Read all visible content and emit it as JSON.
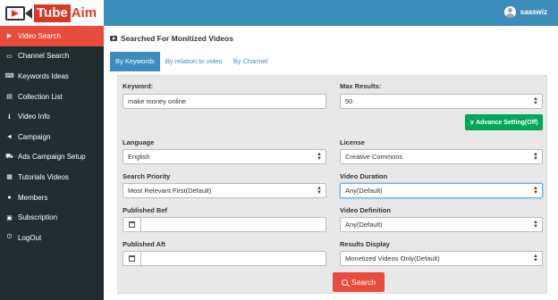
{
  "brand": {
    "tube": "Tube",
    "aim": "Aim"
  },
  "user": {
    "name": "saaswiz"
  },
  "sidebar": {
    "items": [
      {
        "label": "Video Search",
        "icon": "youtube-icon",
        "active": true
      },
      {
        "label": "Channel Search",
        "icon": "monitor-icon"
      },
      {
        "label": "Keywords Ideas",
        "icon": "keyboard-icon"
      },
      {
        "label": "Collection List",
        "icon": "list-icon"
      },
      {
        "label": "Video Info",
        "icon": "info-icon"
      },
      {
        "label": "Campaign",
        "icon": "bullhorn-icon"
      },
      {
        "label": "Ads Campaign Setup",
        "icon": "cart-icon"
      },
      {
        "label": "Tutorials Videos",
        "icon": "film-icon"
      },
      {
        "label": "Members",
        "icon": "user-icon"
      },
      {
        "label": "Subscription",
        "icon": "card-icon"
      },
      {
        "label": "LogOut",
        "icon": "power-icon"
      }
    ]
  },
  "main": {
    "title": "Searched For Monitized Videos",
    "tabs": [
      {
        "label": "By Keywords",
        "active": true
      },
      {
        "label": "By relation to video"
      },
      {
        "label": "By Channel"
      }
    ],
    "form": {
      "keyword": {
        "label": "Keyword:",
        "value": "make money online"
      },
      "max_results": {
        "label": "Max Results:",
        "value": "50"
      },
      "advance_setting": "∨ Advance Setting(Off)",
      "language": {
        "label": "Language",
        "value": "English"
      },
      "license": {
        "label": "License",
        "value": "Creative Commons"
      },
      "search_priority": {
        "label": "Search Priority",
        "value": "Most Relevant First(Default)"
      },
      "video_duration": {
        "label": "Video Duration",
        "value": "Any(Default)"
      },
      "published_bef": {
        "label": "Published Bef",
        "value": ""
      },
      "video_definition": {
        "label": "Video Definition",
        "value": "Any(Default)"
      },
      "published_aft": {
        "label": "Published Aft",
        "value": ""
      },
      "results_display": {
        "label": "Results Display",
        "value": "Monetized Videos Only(Default)"
      }
    },
    "search_button": "Search"
  },
  "colors": {
    "header": "#3c8dbc",
    "sidebar": "#222d32",
    "active": "#e74c3c",
    "success": "#00a65a"
  }
}
